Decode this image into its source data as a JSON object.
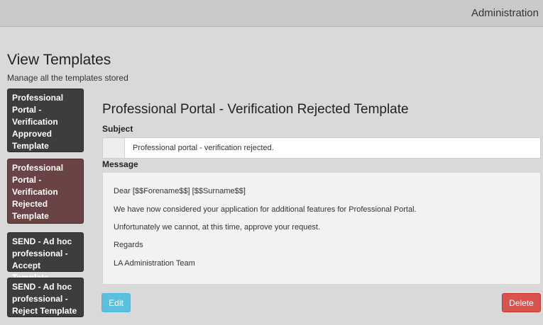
{
  "header": {
    "admin_label": "Administration"
  },
  "page": {
    "title": "View Templates",
    "subtitle": "Manage all the templates stored"
  },
  "sidebar": {
    "items": [
      {
        "label": "Professional Portal - Verification Approved Template",
        "active": false
      },
      {
        "label": "Professional Portal - Verification Rejected Template",
        "active": true
      },
      {
        "label": "SEND - Ad hoc professional - Accept Template",
        "active": false
      },
      {
        "label": "SEND - Ad hoc professional - Reject Template",
        "active": false
      }
    ]
  },
  "detail": {
    "heading": "Professional Portal - Verification Rejected Template",
    "subject_label": "Subject",
    "subject_value": "Professional portal - verification rejected.",
    "message_label": "Message",
    "message_lines": [
      "Dear [$$Forename$$] [$$Surname$$]",
      "We have now considered your application for additional features for Professional Portal.",
      "Unfortunately we cannot, at this time, approve your request.",
      "Regards",
      "LA Administration Team"
    ]
  },
  "actions": {
    "edit_label": "Edit",
    "delete_label": "Delete"
  },
  "colors": {
    "edit": "#5bc0de",
    "delete": "#d9534f",
    "active_item": "#6a4444",
    "item": "#3d3d3d"
  }
}
